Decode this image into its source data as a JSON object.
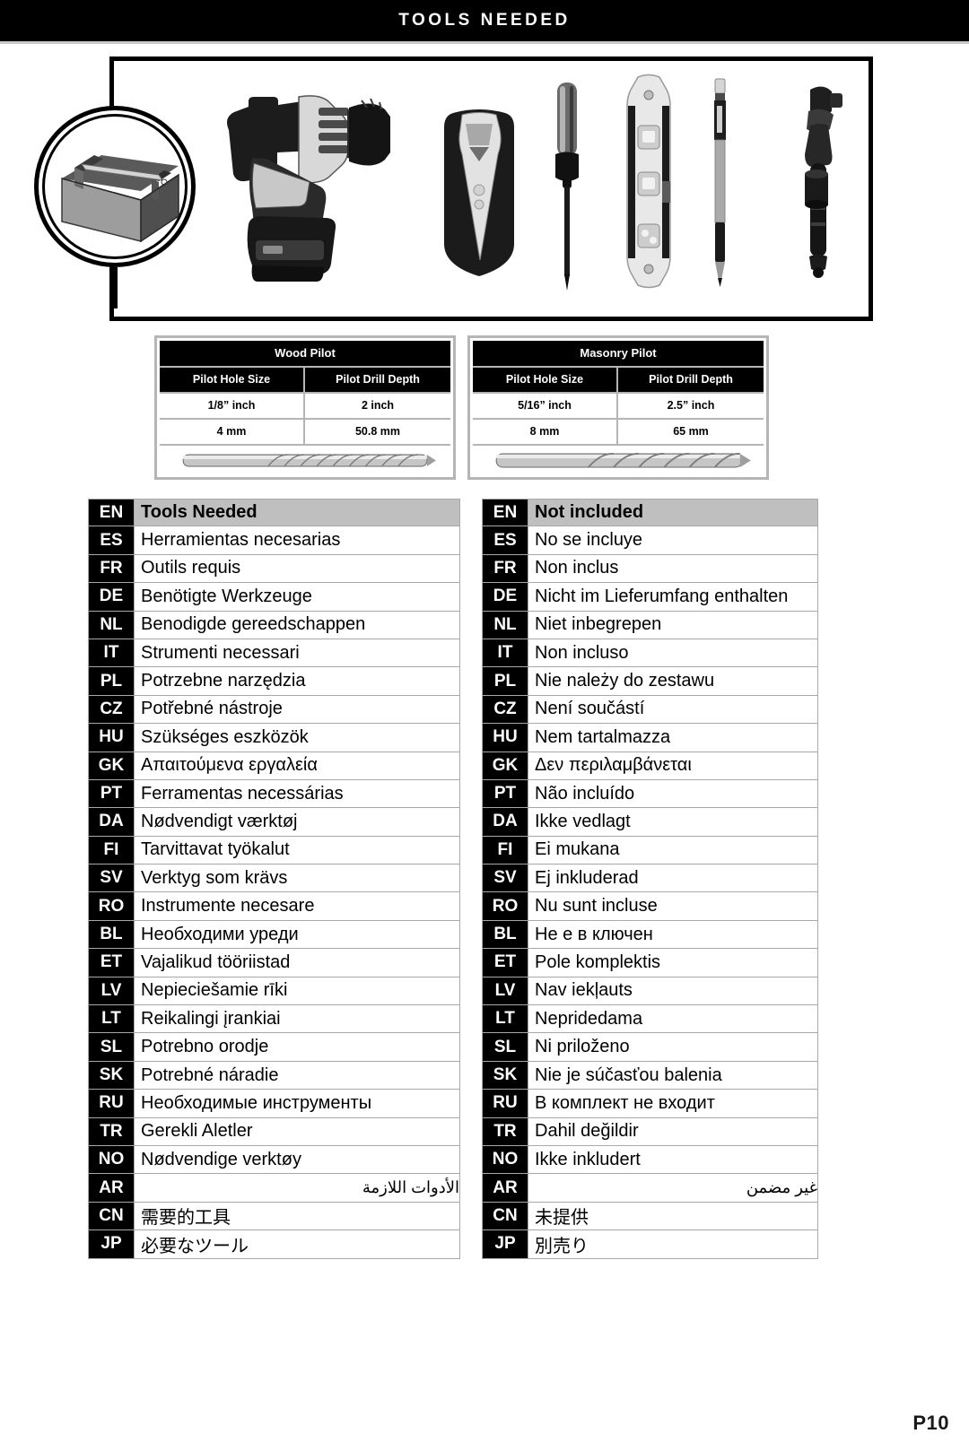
{
  "header": {
    "title": "TOOLS NEEDED"
  },
  "illustration": {
    "badge_icon": "toolbox-icon",
    "tools": [
      "cordless-drill-icon",
      "stud-finder-icon",
      "screwdriver-icon",
      "level-icon",
      "pencil-icon",
      "socket-wrench-icon",
      "socket-icon"
    ]
  },
  "spec_tables": [
    {
      "title": "Wood Pilot",
      "columns": [
        "Pilot Hole Size",
        "Pilot Drill Depth"
      ],
      "rows": [
        [
          "1/8” inch",
          "2 inch"
        ],
        [
          "4 mm",
          "50.8 mm"
        ]
      ],
      "bit_icon": "wood-drill-bit-icon"
    },
    {
      "title": "Masonry Pilot",
      "columns": [
        "Pilot Hole Size",
        "Pilot Drill Depth"
      ],
      "rows": [
        [
          "5/16” inch",
          "2.5” inch"
        ],
        [
          "8 mm",
          "65 mm"
        ]
      ],
      "bit_icon": "masonry-drill-bit-icon"
    }
  ],
  "lang_tables": [
    {
      "name": "tools-needed",
      "rows": [
        {
          "code": "EN",
          "text": "Tools Needed"
        },
        {
          "code": "ES",
          "text": "Herramientas necesarias"
        },
        {
          "code": "FR",
          "text": "Outils requis"
        },
        {
          "code": "DE",
          "text": "Benötigte Werkzeuge"
        },
        {
          "code": "NL",
          "text": "Benodigde gereedschappen"
        },
        {
          "code": "IT",
          "text": "Strumenti necessari"
        },
        {
          "code": "PL",
          "text": "Potrzebne narzędzia"
        },
        {
          "code": "CZ",
          "text": "Potřebné nástroje"
        },
        {
          "code": "HU",
          "text": "Szükséges eszközök"
        },
        {
          "code": "GK",
          "text": "Απαιτούμενα εργαλεία"
        },
        {
          "code": "PT",
          "text": "Ferramentas necessárias"
        },
        {
          "code": "DA",
          "text": "Nødvendigt værktøj"
        },
        {
          "code": "FI",
          "text": "Tarvittavat työkalut"
        },
        {
          "code": "SV",
          "text": "Verktyg som krävs"
        },
        {
          "code": "RO",
          "text": "Instrumente necesare"
        },
        {
          "code": "BL",
          "text": "Необходими уреди"
        },
        {
          "code": "ET",
          "text": "Vajalikud tööriistad"
        },
        {
          "code": "LV",
          "text": "Nepieciešamie rīki"
        },
        {
          "code": "LT",
          "text": "Reikalingi įrankiai"
        },
        {
          "code": "SL",
          "text": "Potrebno orodje"
        },
        {
          "code": "SK",
          "text": "Potrebné náradie"
        },
        {
          "code": "RU",
          "text": "Необходимые инструменты"
        },
        {
          "code": "TR",
          "text": "Gerekli Aletler"
        },
        {
          "code": "NO",
          "text": "Nødvendige verktøy"
        },
        {
          "code": "AR",
          "text": "الأدوات اللازمة"
        },
        {
          "code": "CN",
          "text": "需要的工具"
        },
        {
          "code": "JP",
          "text": "必要なツール"
        }
      ]
    },
    {
      "name": "not-included",
      "rows": [
        {
          "code": "EN",
          "text": "Not included"
        },
        {
          "code": "ES",
          "text": "No se incluye"
        },
        {
          "code": "FR",
          "text": "Non inclus"
        },
        {
          "code": "DE",
          "text": "Nicht im Lieferumfang enthalten"
        },
        {
          "code": "NL",
          "text": "Niet inbegrepen"
        },
        {
          "code": "IT",
          "text": "Non incluso"
        },
        {
          "code": "PL",
          "text": "Nie należy do zestawu"
        },
        {
          "code": "CZ",
          "text": "Není součástí"
        },
        {
          "code": "HU",
          "text": "Nem tartalmazza"
        },
        {
          "code": "GK",
          "text": "Δεν περιλαμβάνεται"
        },
        {
          "code": "PT",
          "text": "Não incluído"
        },
        {
          "code": "DA",
          "text": "Ikke vedlagt"
        },
        {
          "code": "FI",
          "text": "Ei mukana"
        },
        {
          "code": "SV",
          "text": "Ej inkluderad"
        },
        {
          "code": "RO",
          "text": "Nu sunt incluse"
        },
        {
          "code": "BL",
          "text": "Не е в ключен"
        },
        {
          "code": "ET",
          "text": "Pole komplektis"
        },
        {
          "code": "LV",
          "text": "Nav iekļauts"
        },
        {
          "code": "LT",
          "text": "Nepridedama"
        },
        {
          "code": "SL",
          "text": "Ni priloženo"
        },
        {
          "code": "SK",
          "text": "Nie je súčasťou balenia"
        },
        {
          "code": "RU",
          "text": "В комплект не входит"
        },
        {
          "code": "TR",
          "text": "Dahil değildir"
        },
        {
          "code": "NO",
          "text": "Ikke inkludert"
        },
        {
          "code": "AR",
          "text": "غير مضمن"
        },
        {
          "code": "CN",
          "text": "未提供"
        },
        {
          "code": "JP",
          "text": "別売り"
        }
      ]
    }
  ],
  "footer": {
    "page_number": "P10"
  }
}
